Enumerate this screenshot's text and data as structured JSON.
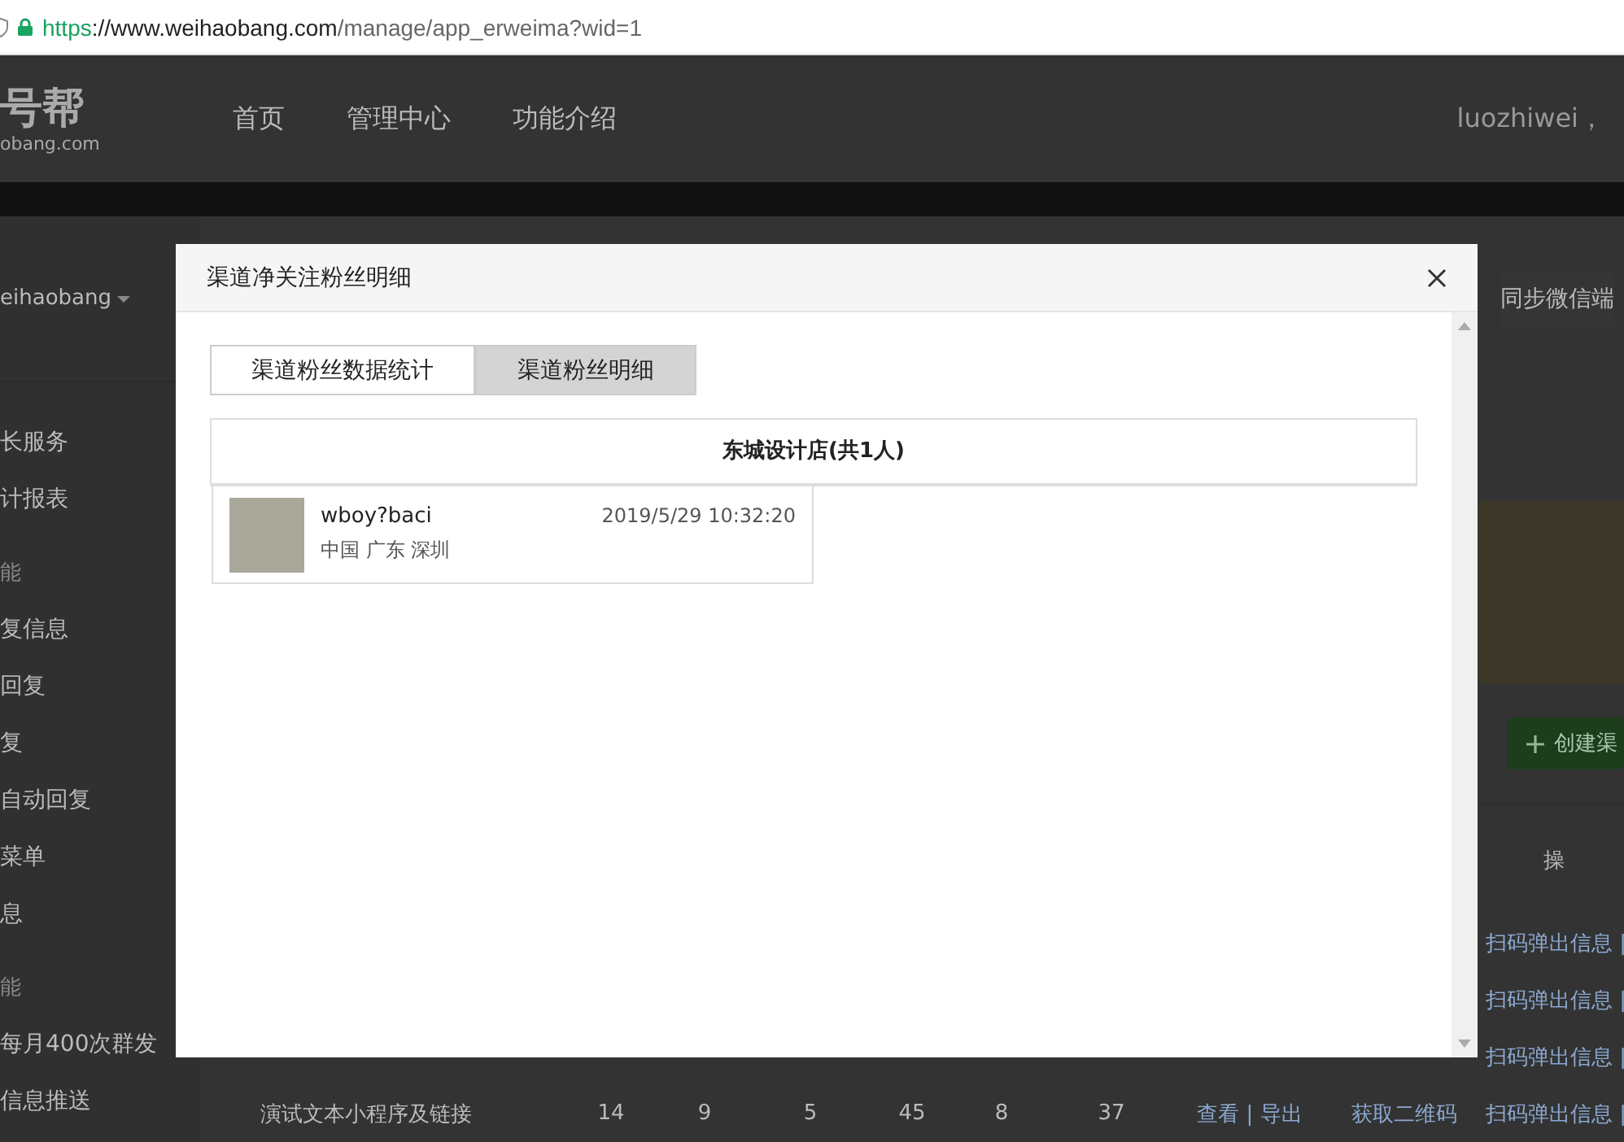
{
  "address_bar": {
    "url_scheme": "https",
    "url_host": "://www.weihaobang.com",
    "url_path": "/manage/app_erweima?wid=1"
  },
  "header": {
    "logo_title": "号帮",
    "logo_domain": "obang.com",
    "nav": [
      "首页",
      "管理中心",
      "功能介绍"
    ],
    "user_greeting": "luozhiwei，"
  },
  "sidebar": {
    "account": "eihaobang",
    "items": [
      {
        "kind": "link",
        "label": "长服务"
      },
      {
        "kind": "link",
        "label": "计报表"
      },
      {
        "kind": "heading",
        "label": "能"
      },
      {
        "kind": "link",
        "label": "复信息"
      },
      {
        "kind": "link",
        "label": "回复"
      },
      {
        "kind": "link",
        "label": "复"
      },
      {
        "kind": "link",
        "label": "自动回复"
      },
      {
        "kind": "link",
        "label": "菜单"
      },
      {
        "kind": "link",
        "label": "息"
      },
      {
        "kind": "heading",
        "label": "能"
      },
      {
        "kind": "link",
        "label": "每月400次群发"
      },
      {
        "kind": "link",
        "label": "信息推送"
      }
    ]
  },
  "main": {
    "sync_button": "同步微信端",
    "create_button": "创建渠",
    "table": {
      "header": [
        "操"
      ],
      "rows": [
        {
          "cells": [
            "扫码弹出信息 |"
          ]
        },
        {
          "cells": [
            "扫码弹出信息 |"
          ]
        },
        {
          "cells": [
            "扫码弹出信息 |"
          ]
        },
        {
          "cells": [
            "演试文本小程序及链接",
            "14",
            "9",
            "5",
            "45",
            "8",
            "37",
            "查看 | 导出",
            "获取二维码",
            "扫码弹出信息 |"
          ]
        }
      ]
    }
  },
  "dialog": {
    "title": "渠道净关注粉丝明细",
    "tabs": [
      {
        "label": "渠道粉丝数据统计",
        "selected": false
      },
      {
        "label": "渠道粉丝明细",
        "selected": true
      }
    ],
    "group": {
      "title": "东城设计店(共1人)",
      "fans": [
        {
          "nickname": "wboy?baci",
          "time": "2019/5/29 10:32:20",
          "location": "中国 广东 深圳"
        }
      ]
    }
  }
}
